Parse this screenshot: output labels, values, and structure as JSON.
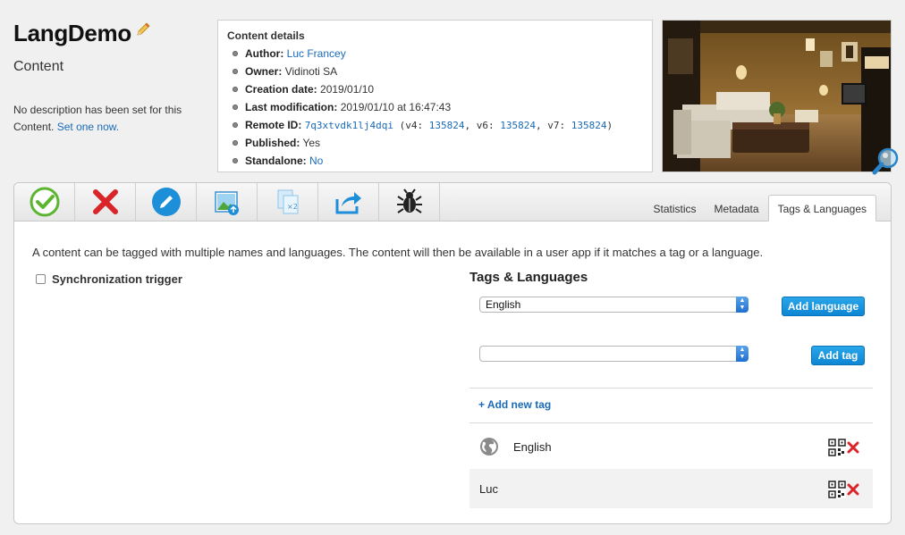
{
  "page": {
    "title": "LangDemo",
    "subtitle": "Content",
    "description": "No description has been set for this Content.",
    "description_link": "Set one now."
  },
  "details": {
    "heading": "Content details",
    "author_label": "Author:",
    "author_value": "Luc Francey",
    "owner_label": "Owner:",
    "owner_value": "Vidinoti SA",
    "creation_label": "Creation date:",
    "creation_value": "2019/01/10",
    "modification_label": "Last modification:",
    "modification_value": "2019/01/10 at 16:47:43",
    "remote_label": "Remote ID:",
    "remote_id": "7q3xtvdk1lj4dqi",
    "remote_v4_label": "(v4:",
    "remote_v4": "135824",
    "remote_v6_label": ", v6:",
    "remote_v6": "135824",
    "remote_v7_label": ", v7:",
    "remote_v7": "135824",
    "remote_close": ")",
    "published_label": "Published:",
    "published_value": "Yes",
    "standalone_label": "Standalone:",
    "standalone_value": "No"
  },
  "toolbar": {
    "icons": [
      "check-icon",
      "delete-icon",
      "edit-icon",
      "image-upload-icon",
      "duplicate-icon",
      "share-icon",
      "debug-icon"
    ],
    "tabs": [
      "Statistics",
      "Metadata",
      "Tags & Languages"
    ],
    "active_tab": "Tags & Languages"
  },
  "main": {
    "intro": "A content can be tagged with multiple names and languages. The content will then be available in a user app if it matches a tag or a language.",
    "sync_label": "Synchronization trigger",
    "tags_heading": "Tags & Languages",
    "language_select": "English",
    "tag_select": "",
    "add_language_button": "Add language",
    "add_tag_button": "Add tag",
    "add_new_tag_link": "+ Add new tag",
    "rows": [
      {
        "label": "English",
        "type": "language"
      },
      {
        "label": "Luc",
        "type": "tag"
      }
    ]
  },
  "colors": {
    "link": "#1a6bb8",
    "button": "#0d86d3",
    "delete": "#d9252a",
    "check": "#5cb531"
  }
}
